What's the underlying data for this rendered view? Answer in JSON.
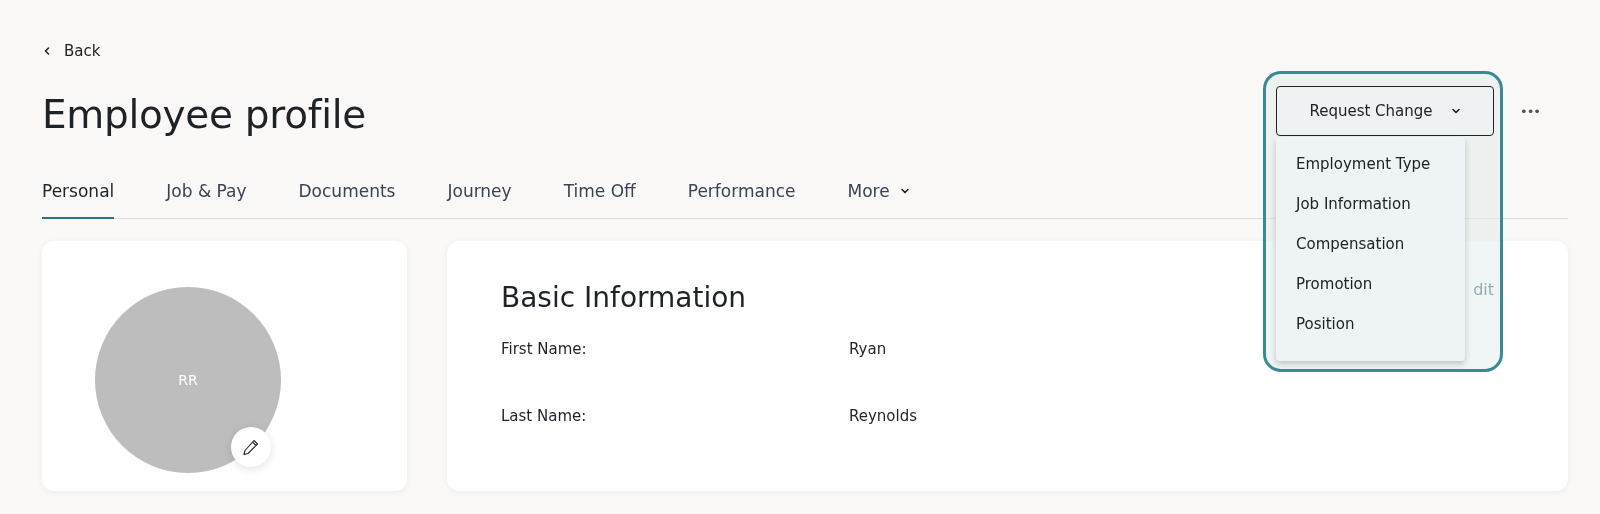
{
  "back": {
    "label": "Back"
  },
  "title": "Employee profile",
  "actions": {
    "request_change": {
      "label": "Request Change",
      "expanded": true
    },
    "more": {
      "label": "•••"
    }
  },
  "menu": {
    "items": [
      {
        "label": "Employment Type"
      },
      {
        "label": "Job Information"
      },
      {
        "label": "Compensation"
      },
      {
        "label": "Promotion"
      },
      {
        "label": "Position"
      }
    ]
  },
  "tabs": [
    {
      "label": "Personal",
      "selected": true,
      "dropdown": false
    },
    {
      "label": "Job & Pay",
      "selected": false,
      "dropdown": false
    },
    {
      "label": "Documents",
      "selected": false,
      "dropdown": false
    },
    {
      "label": "Journey",
      "selected": false,
      "dropdown": false
    },
    {
      "label": "Time Off",
      "selected": false,
      "dropdown": false
    },
    {
      "label": "Performance",
      "selected": false,
      "dropdown": false
    },
    {
      "label": "More",
      "selected": false,
      "dropdown": true
    }
  ],
  "profile_card": {
    "initials": "RR"
  },
  "basic_information": {
    "title": "Basic Information",
    "edit": "dit",
    "fields": [
      {
        "label": "First Name:",
        "value": "Ryan"
      },
      {
        "label": "Last Name:",
        "value": "Reynolds"
      }
    ]
  }
}
